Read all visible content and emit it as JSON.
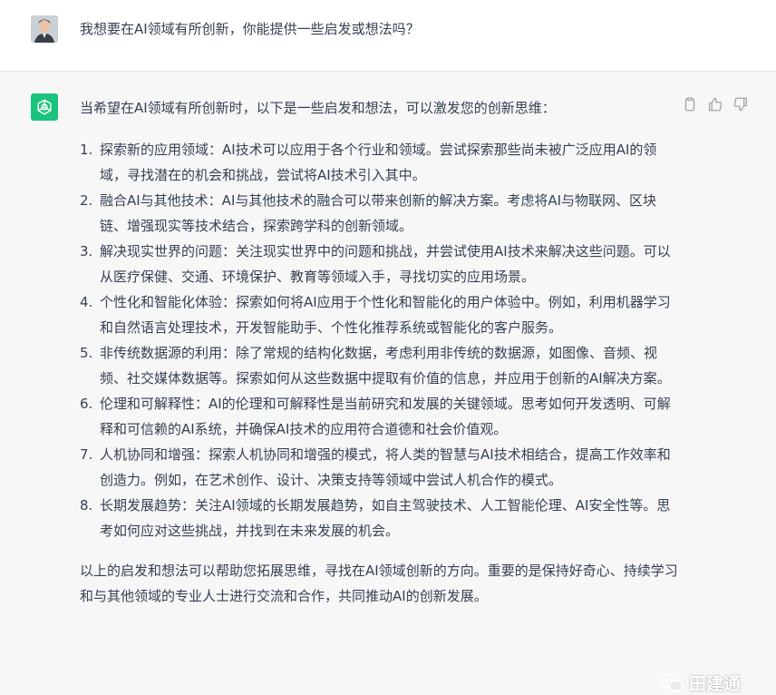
{
  "user_message": {
    "text": "我想要在AI领域有所创新，你能提供一些启发或想法吗？"
  },
  "assistant_message": {
    "intro": "当希望在AI领域有所创新时，以下是一些启发和想法，可以激发您的创新思维：",
    "items": [
      {
        "num": "1.",
        "text": "探索新的应用领域：AI技术可以应用于各个行业和领域。尝试探索那些尚未被广泛应用AI的领域，寻找潜在的机会和挑战，尝试将AI技术引入其中。"
      },
      {
        "num": "2.",
        "text": "融合AI与其他技术：AI与其他技术的融合可以带来创新的解决方案。考虑将AI与物联网、区块链、增强现实等技术结合，探索跨学科的创新领域。"
      },
      {
        "num": "3.",
        "text": "解决现实世界的问题：关注现实世界中的问题和挑战，并尝试使用AI技术来解决这些问题。可以从医疗保健、交通、环境保护、教育等领域入手，寻找切实的应用场景。"
      },
      {
        "num": "4.",
        "text": "个性化和智能化体验：探索如何将AI应用于个性化和智能化的用户体验中。例如，利用机器学习和自然语言处理技术，开发智能助手、个性化推荐系统或智能化的客户服务。"
      },
      {
        "num": "5.",
        "text": "非传统数据源的利用：除了常规的结构化数据，考虑利用非传统的数据源，如图像、音频、视频、社交媒体数据等。探索如何从这些数据中提取有价值的信息，并应用于创新的AI解决方案。"
      },
      {
        "num": "6.",
        "text": "伦理和可解释性：AI的伦理和可解释性是当前研究和发展的关键领域。思考如何开发透明、可解释和可信赖的AI系统，并确保AI技术的应用符合道德和社会价值观。"
      },
      {
        "num": "7.",
        "text": "人机协同和增强：探索人机协同和增强的模式，将人类的智慧与AI技术相结合，提高工作效率和创造力。例如，在艺术创作、设计、决策支持等领域中尝试人机合作的模式。"
      },
      {
        "num": "8.",
        "text": "长期发展趋势：关注AI领域的长期发展趋势，如自主驾驶技术、人工智能伦理、AI安全性等。思考如何应对这些挑战，并找到在未来发展的机会。"
      }
    ],
    "outro": "以上的启发和想法可以帮助您拓展思维，寻找在AI领域创新的方向。重要的是保持好奇心、持续学习和与其他领域的专业人士进行交流和合作，共同推动AI的创新发展。"
  },
  "watermark": {
    "text": "田建通"
  },
  "icons": {
    "copy": "clipboard-icon",
    "like": "thumbs-up-icon",
    "dislike": "thumbs-down-icon",
    "bot": "openai-logo-icon"
  },
  "colors": {
    "bot_avatar_bg": "#19c37d",
    "assistant_bg": "#f7f7f8",
    "user_bg": "#ffffff",
    "text": "#374151"
  }
}
